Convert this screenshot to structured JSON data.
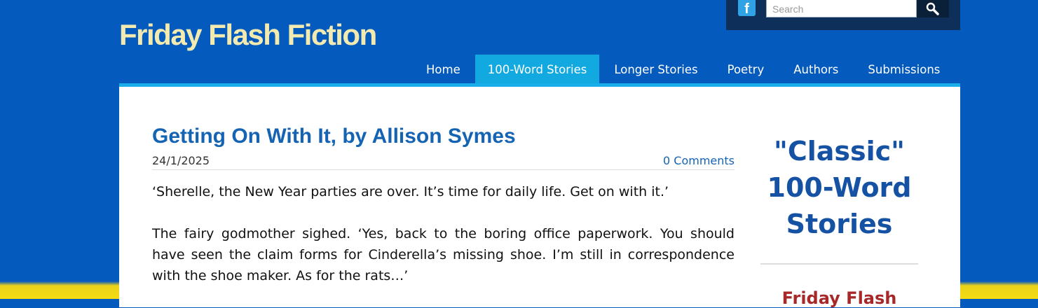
{
  "site": {
    "title": "Friday Flash Fiction"
  },
  "topbar": {
    "facebook_icon": "facebook-icon",
    "search_placeholder": "Search",
    "search_icon": "magnifier-icon"
  },
  "nav": {
    "items": [
      "Home",
      "100-Word Stories",
      "Longer Stories",
      "Poetry",
      "Authors",
      "Submissions"
    ],
    "active": "100-Word Stories"
  },
  "post": {
    "title": "Getting On With It, by Allison Symes",
    "date": "24/1/2025",
    "comments": "0 Comments",
    "paragraphs": [
      "‘Sherelle, the New Year parties are over. It’s time for daily life. Get on with it.’",
      "The fairy godmother sighed. ‘Yes, back to the boring office paperwork. You should have seen the claim forms for Cinderella’s missing shoe. I’m still in correspondence with the shoe maker. As for the rats…’"
    ]
  },
  "sidebar": {
    "heading": "\"Classic\" 100-Word Stories",
    "subheading": "Friday Flash"
  },
  "colors": {
    "background": "#055abd",
    "accent": "#11a9e0",
    "title": "#f3eab0",
    "link": "#1563b3",
    "sidebar_heading": "#1652a4",
    "sidebar_subheading": "#a8282a"
  }
}
